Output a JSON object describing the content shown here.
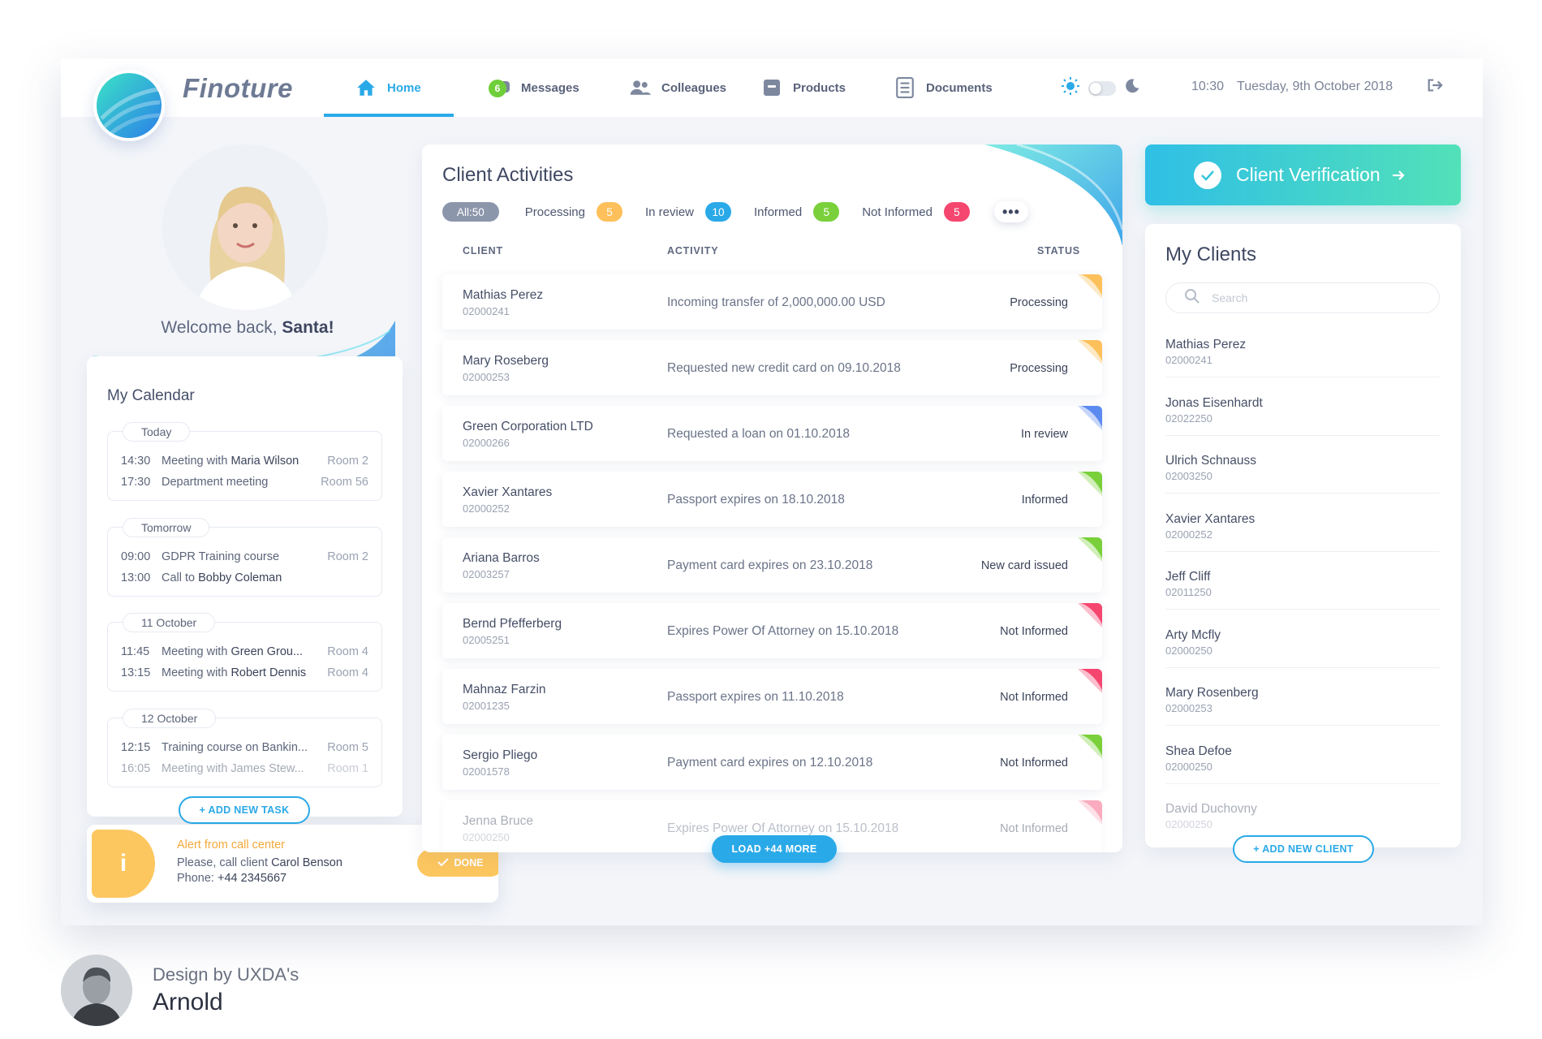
{
  "app": {
    "brand": "Finoture"
  },
  "nav": {
    "items": [
      {
        "label": "Home",
        "icon": "home-icon"
      },
      {
        "label": "Messages",
        "icon": "chat-icon",
        "badge": "6"
      },
      {
        "label": "Colleagues",
        "icon": "people-icon"
      },
      {
        "label": "Products",
        "icon": "box-icon"
      },
      {
        "label": "Documents",
        "icon": "document-icon"
      }
    ]
  },
  "header": {
    "time": "10:30",
    "date": "Tuesday, 9th October 2018"
  },
  "profile": {
    "welcome_prefix": "Welcome back,",
    "name": "Santa!"
  },
  "calendar": {
    "title": "My Calendar",
    "days": [
      {
        "label": "Today",
        "events": [
          {
            "time": "14:30",
            "text": "Meeting with ",
            "who": "Maria Wilson",
            "room": "Room 2"
          },
          {
            "time": "17:30",
            "text": "Department meeting",
            "who": "",
            "room": "Room 56"
          }
        ]
      },
      {
        "label": "Tomorrow",
        "events": [
          {
            "time": "09:00",
            "text": "GDPR Training course",
            "who": "",
            "room": "Room 2"
          },
          {
            "time": "13:00",
            "text": "Call to ",
            "who": "Bobby Coleman",
            "room": ""
          }
        ]
      },
      {
        "label": "11 October",
        "events": [
          {
            "time": "11:45",
            "text": "Meeting with ",
            "who": "Green Grou...",
            "room": "Room 4"
          },
          {
            "time": "13:15",
            "text": "Meeting with ",
            "who": "Robert Dennis",
            "room": "Room 4"
          }
        ]
      },
      {
        "label": "12 October",
        "events": [
          {
            "time": "12:15",
            "text": "Training course on Bankin...",
            "who": "",
            "room": "Room 5"
          },
          {
            "time": "16:05",
            "text": "Meeting with James Stew...",
            "who": "",
            "room": "Room 1"
          }
        ]
      }
    ],
    "add_task_label": "+ ADD NEW TASK"
  },
  "alert": {
    "title": "Alert from call center",
    "line1_prefix": "Please, call client ",
    "line1_name": "Carol Benson",
    "line2_prefix": "Phone: ",
    "line2_phone": "+44 2345667",
    "done_label": "DONE",
    "icon_glyph": "i"
  },
  "activities": {
    "title": "Client Activities",
    "filter_all": "All:50",
    "filters": [
      {
        "label": "Processing",
        "count": "5",
        "color": "#fdc05a"
      },
      {
        "label": "In review",
        "count": "10",
        "color": "#2aa9e8"
      },
      {
        "label": "Informed",
        "count": "5",
        "color": "#7ad03a"
      },
      {
        "label": "Not Informed",
        "count": "5",
        "color": "#f5466f"
      }
    ],
    "more_label": "•••",
    "columns": {
      "client": "CLIENT",
      "activity": "ACTIVITY",
      "status": "STATUS"
    },
    "rows": [
      {
        "name": "Mathias Perez",
        "id": "02000241",
        "activity": "Incoming transfer of 2,000,000.00 USD",
        "status": "Processing",
        "flag": "#fdc05a"
      },
      {
        "name": "Mary Roseberg",
        "id": "02000253",
        "activity": "Requested new credit card on 09.10.2018",
        "status": "Processing",
        "flag": "#fdc05a"
      },
      {
        "name": "Green Corporation LTD",
        "id": "02000266",
        "activity": "Requested a loan on 01.10.2018",
        "status": "In review",
        "flag": "#5b8af0"
      },
      {
        "name": "Xavier Xantares",
        "id": "02000252",
        "activity": "Passport expires on 18.10.2018",
        "status": "Informed",
        "flag": "#7ad03a"
      },
      {
        "name": "Ariana Barros",
        "id": "02003257",
        "activity": "Payment card expires on 23.10.2018",
        "status": "New card issued",
        "flag": "#7ad03a"
      },
      {
        "name": "Bernd Pfefferberg",
        "id": "02005251",
        "activity": "Expires Power Of Attorney on 15.10.2018",
        "status": "Not Informed",
        "flag": "#f5466f"
      },
      {
        "name": "Mahnaz Farzin",
        "id": "02001235",
        "activity": "Passport expires on 11.10.2018",
        "status": "Not Informed",
        "flag": "#f5466f"
      },
      {
        "name": "Sergio Pliego",
        "id": "02001578",
        "activity": "Payment card expires on 12.10.2018",
        "status": "Not Informed",
        "flag": "#7ad03a"
      },
      {
        "name": "Jenna Bruce",
        "id": "02000250",
        "activity": "Expires Power Of Attorney on 15.10.2018",
        "status": "Not Informed",
        "flag": "#f5466f"
      }
    ],
    "load_more_label": "LOAD +44 MORE"
  },
  "verification": {
    "label": "Client Verification"
  },
  "clients": {
    "title": "My Clients",
    "search_placeholder": "Search",
    "items": [
      {
        "name": "Mathias Perez",
        "id": "02000241"
      },
      {
        "name": "Jonas Eisenhardt",
        "id": "02022250"
      },
      {
        "name": "Ulrich Schnauss",
        "id": "02003250"
      },
      {
        "name": "Xavier Xantares",
        "id": "02000252"
      },
      {
        "name": "Jeff Cliff",
        "id": "02011250"
      },
      {
        "name": "Arty Mcfly",
        "id": "02000250"
      },
      {
        "name": "Mary Rosenberg",
        "id": "02000253"
      },
      {
        "name": "Shea Defoe",
        "id": "02000250"
      },
      {
        "name": "David Duchovny",
        "id": "02000250"
      }
    ],
    "add_client_label": "+ ADD NEW CLIENT"
  },
  "credit": {
    "design_by": "Design by UXDA's",
    "designer": "Arnold"
  },
  "colors": {
    "accent": "#2aa9e8",
    "processing": "#fdc05a",
    "review": "#2aa9e8",
    "informed": "#7ad03a",
    "not_informed": "#f5466f",
    "alert": "#fdc760"
  }
}
